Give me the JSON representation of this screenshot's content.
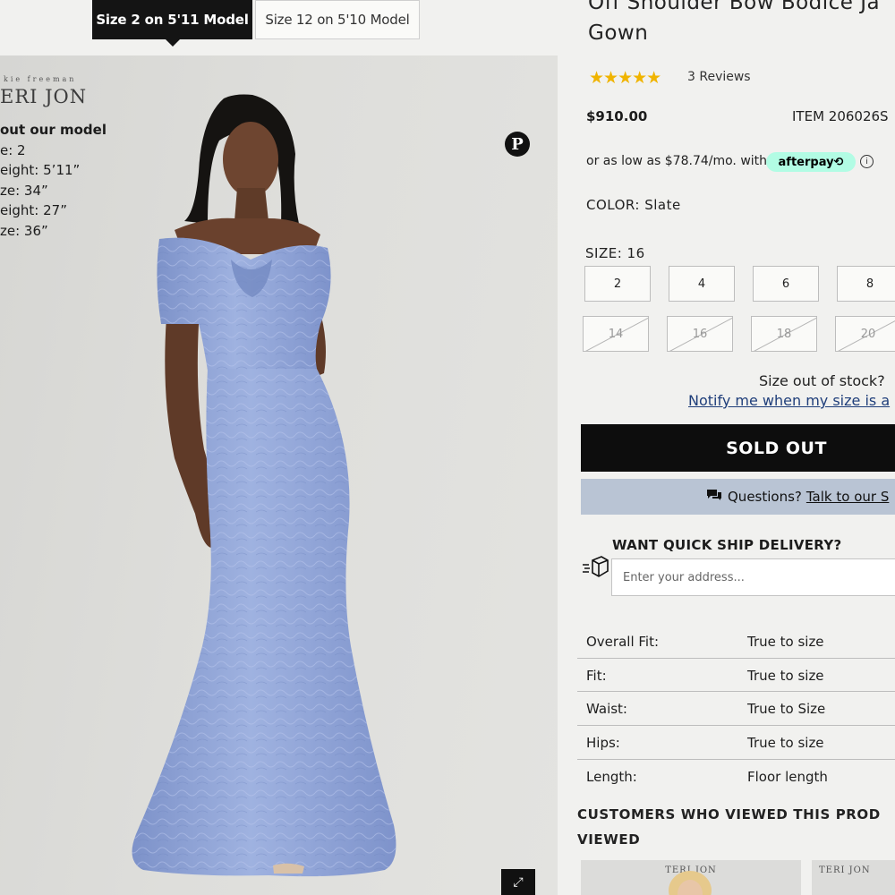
{
  "model_tabs": [
    {
      "label": "Size 2 on 5'11 Model",
      "active": true
    },
    {
      "label": "Size 12 on 5'10 Model",
      "active": false
    }
  ],
  "image_panel": {
    "brand_tagline": "kie freeman",
    "brand_name": "ERI JON",
    "model_heading": "out our model",
    "model_stats": [
      "e: 2",
      "eight: 5’11”",
      "ze: 34”",
      "eight: 27”",
      "ze: 36”"
    ],
    "pinterest_icon": "pinterest-icon",
    "zoom_icon": "expand-icon",
    "pinterest_glyph": "P",
    "zoom_glyph": "⤢"
  },
  "product": {
    "title_line1": "Off Shoulder Bow Bodice Ja",
    "title_line2": "Gown",
    "rating_stars": "★★★★★",
    "rating": 5,
    "reviews": "3 Reviews",
    "price": "$910.00",
    "item_number": "ITEM 206026S",
    "afterpay_text": "or as low as $78.74/mo. with",
    "afterpay_badge": "afterpay⟲",
    "info_glyph": "i",
    "color_label": "COLOR: Slate",
    "size_label": "SIZE: 16",
    "sizes": [
      {
        "label": "2",
        "in_stock": true
      },
      {
        "label": "4",
        "in_stock": true
      },
      {
        "label": "6",
        "in_stock": true
      },
      {
        "label": "8",
        "in_stock": true
      },
      {
        "label": "14",
        "in_stock": false
      },
      {
        "label": "16",
        "in_stock": false
      },
      {
        "label": "18",
        "in_stock": false
      },
      {
        "label": "20",
        "in_stock": false
      }
    ],
    "size_oos_question": "Size out of stock?",
    "notify_link": "Notify me when my size is a",
    "sold_out_button": "SOLD OUT",
    "questions_label": "Questions?",
    "questions_link": "Talk to our S",
    "chat_icon": "chat-icon"
  },
  "quick_ship": {
    "heading": "WANT QUICK SHIP DELIVERY?",
    "placeholder": "Enter your address...",
    "icon": "shipping-box-icon"
  },
  "fit_details": [
    {
      "label": "Overall Fit:",
      "value": "True to size"
    },
    {
      "label": "Fit:",
      "value": "True to size"
    },
    {
      "label": "Waist:",
      "value": "True to Size"
    },
    {
      "label": "Hips:",
      "value": "True to size"
    },
    {
      "label": "Length:",
      "value": "Floor length"
    }
  ],
  "recommendations": {
    "heading_line1": "CUSTOMERS WHO VIEWED THIS PROD",
    "heading_line2": "VIEWED",
    "cards": [
      {
        "brand": "TERI JON"
      },
      {
        "brand": "TERI JON"
      }
    ]
  },
  "colors": {
    "dress": "#8da2d6",
    "afterpay_mint": "#b2fce4",
    "star": "#f0b400",
    "link": "#1f3e7a",
    "questions_bg": "#b9c4d4"
  }
}
